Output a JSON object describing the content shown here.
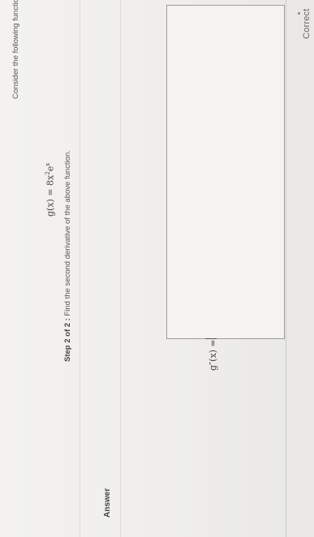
{
  "status": {
    "correct_label": "Correct"
  },
  "problem": {
    "intro": "Consider the following function:",
    "function_lhs": "g(x)",
    "function_eq": "=",
    "function_coef": "8x",
    "function_exp1": "2",
    "function_base": "e",
    "function_exp2": "x",
    "step_label": "Step 2 of 2 :",
    "step_text": "Find the second derivative of the above function."
  },
  "answer": {
    "heading": "Answer",
    "lhs": "g″(x)",
    "eq": "="
  }
}
